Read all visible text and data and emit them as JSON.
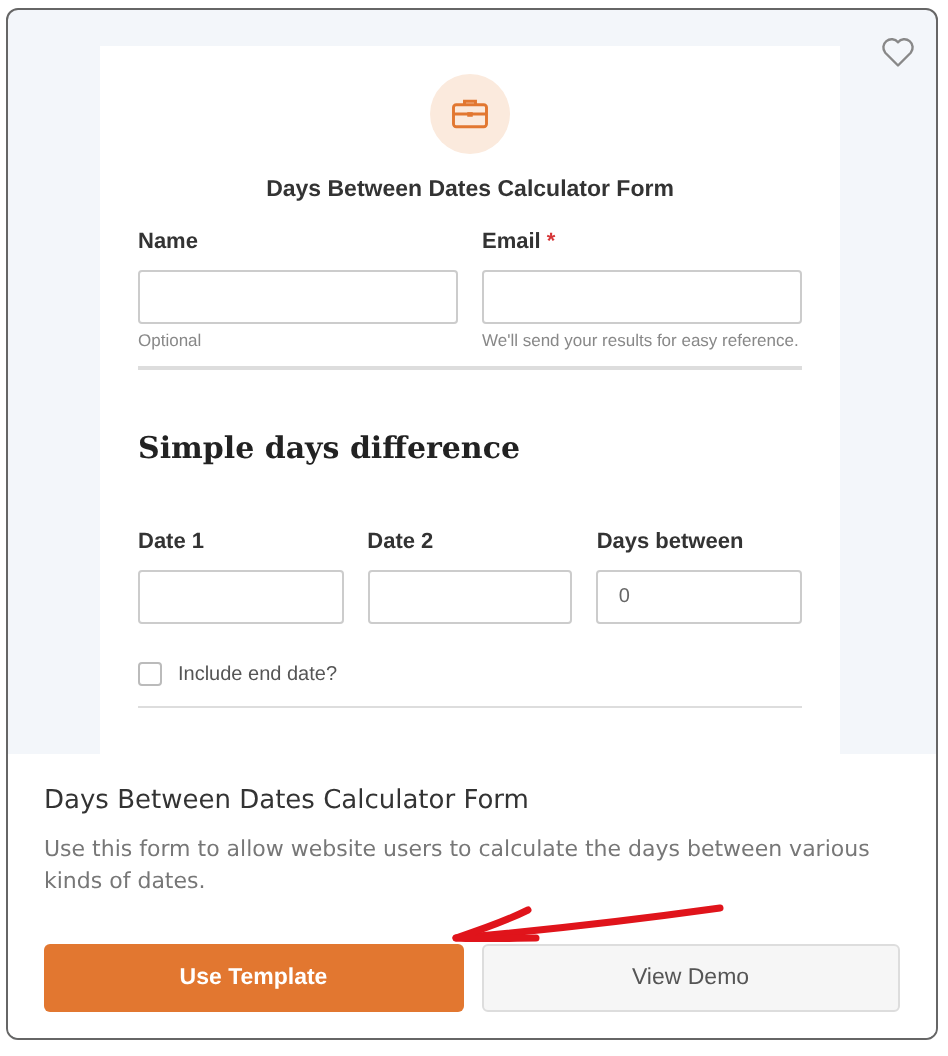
{
  "form": {
    "title": "Days Between Dates Calculator Form",
    "contact_fields": [
      {
        "label": "Name",
        "hint": "Optional"
      },
      {
        "label": "Email",
        "required_mark": "*",
        "hint": "We'll send your results for easy reference."
      }
    ],
    "section_heading": "Simple days difference",
    "date_fields": [
      {
        "label": "Date 1"
      },
      {
        "label": "Date 2"
      },
      {
        "label": "Days between",
        "value": "0"
      }
    ],
    "checkbox": {
      "label": "Include end date?",
      "checked": false
    }
  },
  "template": {
    "title": "Days Between Dates Calculator Form",
    "description": "Use this form to allow website users to calculate the days between various kinds of dates.",
    "buttons": [
      {
        "label": "Use Template",
        "kind": "primary"
      },
      {
        "label": "View Demo",
        "kind": "secondary"
      }
    ]
  }
}
